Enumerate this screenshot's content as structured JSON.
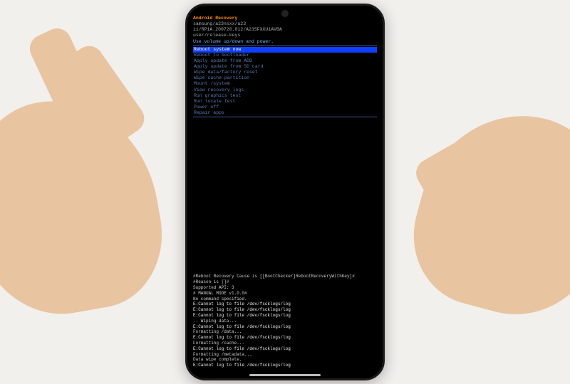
{
  "header": {
    "title": "Android Recovery",
    "device": "samsung/a23nsxx/a23",
    "build": "11/RP1A.200720.012/A235FXXU1AVBA",
    "keys": "user/release-keys",
    "instruction": "Use volume up/down and power."
  },
  "menu": {
    "items": [
      {
        "label": "Reboot system now",
        "selected": true
      },
      {
        "label": "Reboot to bootloader",
        "selected": false
      },
      {
        "label": "Apply update from ADB",
        "selected": false
      },
      {
        "label": "Apply update from SD card",
        "selected": false
      },
      {
        "label": "Wipe data/factory reset",
        "selected": false
      },
      {
        "label": "Wipe cache partition",
        "selected": false
      },
      {
        "label": "Mount /system",
        "selected": false
      },
      {
        "label": "View recovery logs",
        "selected": false
      },
      {
        "label": "Run graphics test",
        "selected": false
      },
      {
        "label": "Run locale test",
        "selected": false
      },
      {
        "label": "Power off",
        "selected": false
      },
      {
        "label": "Repair apps",
        "selected": false
      }
    ]
  },
  "log": {
    "lines": [
      "#Reboot Recovery Cause is [[BootChecker]RebootRecoveryWithKey]#",
      "#Reason is []#",
      "Supported API: 3",
      "",
      "# MANUAL MODE v1.0.0#",
      "No command specified.",
      "E:Cannot log to file /dev/fscklogs/log",
      "",
      "E:Cannot log to file /dev/fscklogs/log",
      "",
      "E:Cannot log to file /dev/fscklogs/log",
      "",
      "",
      "-- Wiping data...",
      "E:Cannot log to file /dev/fscklogs/log",
      "",
      "Formatting /data...",
      "E:Cannot log to file /dev/fscklogs/log",
      "",
      "Formatting /cache...",
      "E:Cannot log to file /dev/fscklogs/log",
      "",
      "Formatting /metadata...",
      "Data wipe complete.",
      "E:Cannot log to file /dev/fscklogs/log"
    ]
  }
}
